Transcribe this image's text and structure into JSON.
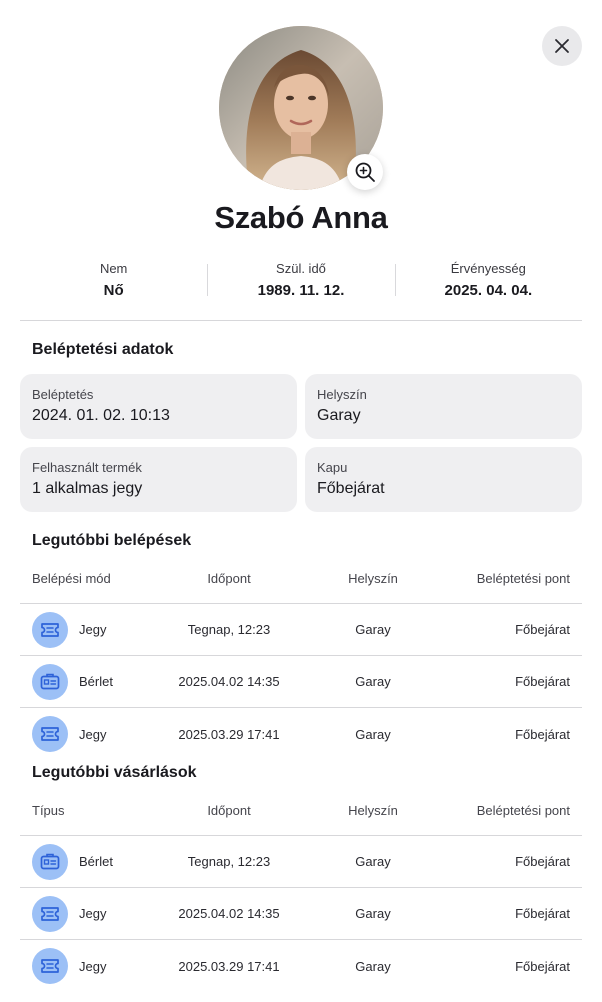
{
  "profile": {
    "name": "Szabó Anna",
    "info": [
      {
        "label": "Nem",
        "value": "Nő"
      },
      {
        "label": "Szül. idő",
        "value": "1989. 11. 12."
      },
      {
        "label": "Érvényesség",
        "value": "2025. 04. 04."
      }
    ]
  },
  "icons": {
    "close": "close-icon",
    "zoom": "zoom-in-icon",
    "ticket": "ticket-icon",
    "pass": "pass-card-icon"
  },
  "colors": {
    "icon_bg": "#9cc0f6",
    "icon_fg": "#2d62d8",
    "card_bg": "#efeff1"
  },
  "entry_data": {
    "title": "Beléptetési adatok",
    "cards": [
      {
        "label": "Beléptetés",
        "value": "2024. 01. 02. 10:13"
      },
      {
        "label": "Helyszín",
        "value": "Garay"
      },
      {
        "label": "Felhasznált termék",
        "value": "1 alkalmas jegy"
      },
      {
        "label": "Kapu",
        "value": "Főbejárat"
      }
    ]
  },
  "recent_entries": {
    "title": "Legutóbbi belépések",
    "headers": [
      "Belépési mód",
      "Időpont",
      "Helyszín",
      "Beléptetési pont"
    ],
    "rows": [
      {
        "icon": "ticket",
        "type": "Jegy",
        "time": "Tegnap, 12:23",
        "place": "Garay",
        "point": "Főbejárat"
      },
      {
        "icon": "pass",
        "type": "Bérlet",
        "time": "2025.04.02 14:35",
        "place": "Garay",
        "point": "Főbejárat"
      },
      {
        "icon": "ticket",
        "type": "Jegy",
        "time": "2025.03.29 17:41",
        "place": "Garay",
        "point": "Főbejárat"
      }
    ]
  },
  "recent_purchases": {
    "title": "Legutóbbi vásárlások",
    "headers": [
      "Típus",
      "Időpont",
      "Helyszín",
      "Beléptetési pont"
    ],
    "rows": [
      {
        "icon": "pass",
        "type": "Bérlet",
        "time": "Tegnap, 12:23",
        "place": "Garay",
        "point": "Főbejárat"
      },
      {
        "icon": "ticket",
        "type": "Jegy",
        "time": "2025.04.02 14:35",
        "place": "Garay",
        "point": "Főbejárat"
      },
      {
        "icon": "ticket",
        "type": "Jegy",
        "time": "2025.03.29 17:41",
        "place": "Garay",
        "point": "Főbejárat"
      }
    ]
  }
}
